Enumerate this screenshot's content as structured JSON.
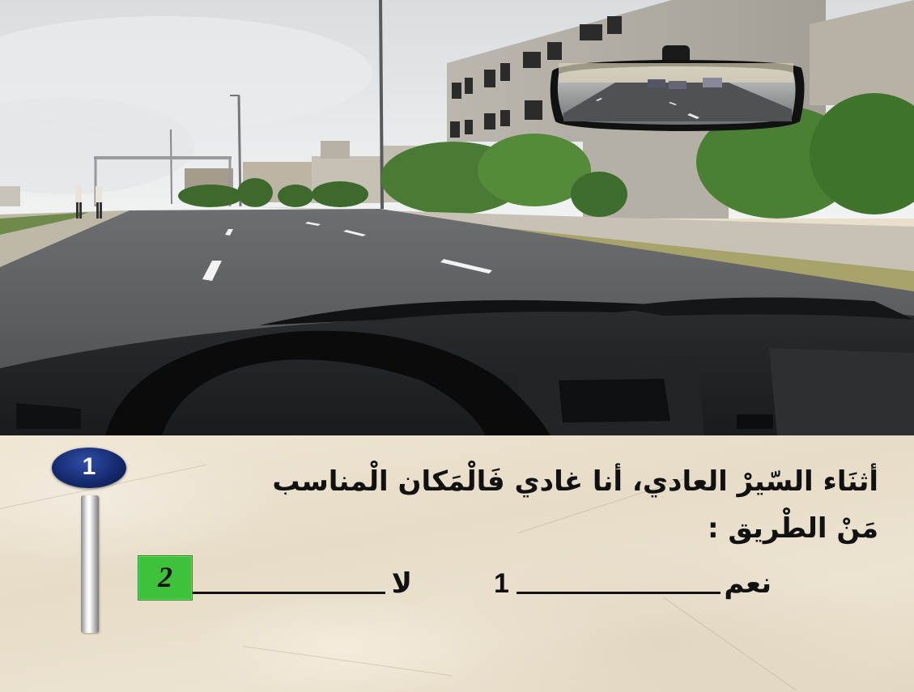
{
  "question": {
    "number": "1",
    "line1": "أثنَاء السّيرْ العادي، أنا غادي فَالْمَكان الْمناسب",
    "line2": "مَنْ الطْريق :"
  },
  "answers": [
    {
      "label": "نعم",
      "number": "1"
    },
    {
      "label": "لا",
      "number": "2"
    }
  ],
  "colors": {
    "selected_answer": "#3ec23a",
    "badge": "#14286a"
  },
  "icons": {
    "question_badge": "oval-number-badge",
    "progress_pole": "vertical-metal-bar"
  }
}
